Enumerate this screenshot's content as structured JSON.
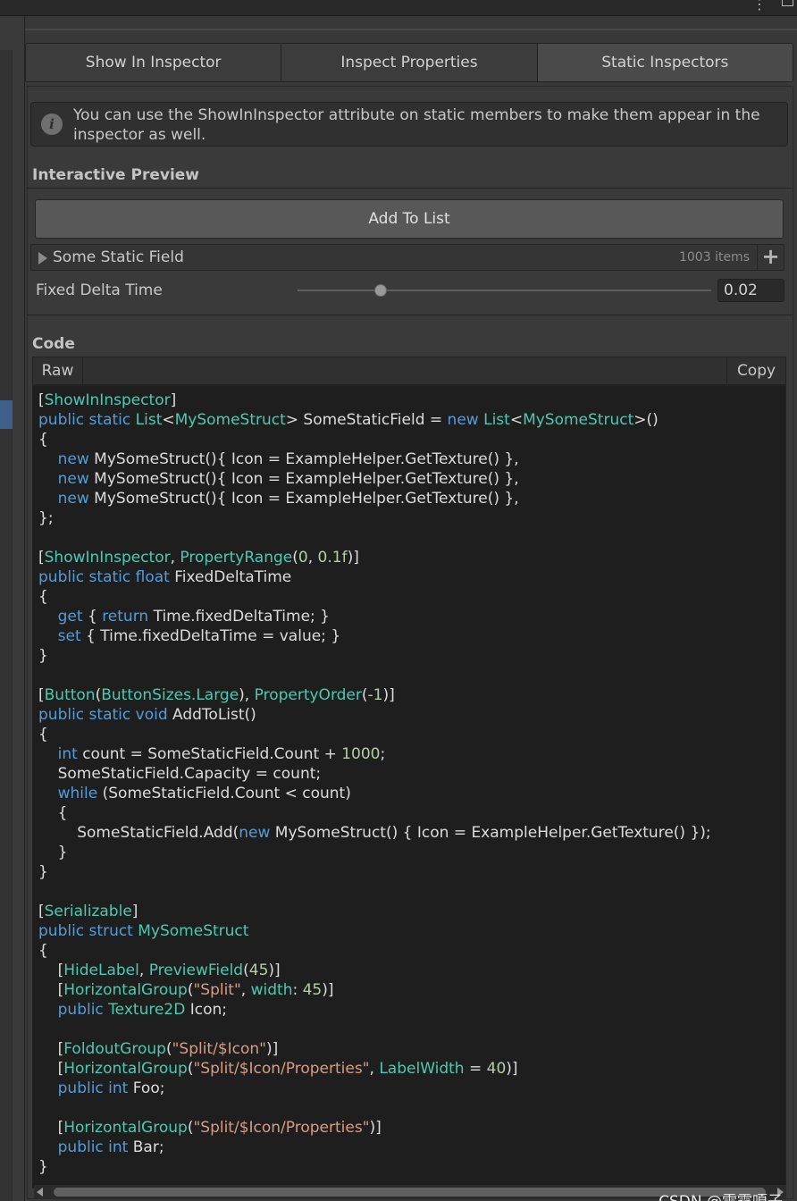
{
  "tabs": [
    {
      "label": "Show In Inspector"
    },
    {
      "label": "Inspect Properties"
    },
    {
      "label": "Static Inspectors"
    }
  ],
  "info": {
    "icon": "info-icon",
    "text": "You can use the ShowInInspector attribute on static members to make them appear in the inspector as well."
  },
  "preview": {
    "title": "Interactive Preview",
    "add_button": "Add To List",
    "list": {
      "label": "Some Static Field",
      "count": "1003 items",
      "add_icon": "plus-icon"
    },
    "slider": {
      "label": "Fixed Delta Time",
      "value": "0.02",
      "min": 0,
      "max": 0.1,
      "level": 0.2
    }
  },
  "code_section": {
    "title": "Code",
    "raw_label": "Raw",
    "copy_label": "Copy",
    "lines": [
      [
        [
          "d",
          "["
        ],
        [
          "t",
          "ShowInInspector"
        ],
        [
          "d",
          "]"
        ]
      ],
      [
        [
          "k",
          "public static "
        ],
        [
          "t",
          "List"
        ],
        [
          "d",
          "<"
        ],
        [
          "t",
          "MySomeStruct"
        ],
        [
          "d",
          "> SomeStaticField = "
        ],
        [
          "k",
          "new "
        ],
        [
          "t",
          "List"
        ],
        [
          "d",
          "<"
        ],
        [
          "t",
          "MySomeStruct"
        ],
        [
          "d",
          ">()"
        ]
      ],
      [
        [
          "d",
          "{"
        ]
      ],
      [
        [
          "d",
          "    "
        ],
        [
          "k",
          "new "
        ],
        [
          "d",
          "MySomeStruct(){ Icon = ExampleHelper.GetTexture() },"
        ]
      ],
      [
        [
          "d",
          "    "
        ],
        [
          "k",
          "new "
        ],
        [
          "d",
          "MySomeStruct(){ Icon = ExampleHelper.GetTexture() },"
        ]
      ],
      [
        [
          "d",
          "    "
        ],
        [
          "k",
          "new "
        ],
        [
          "d",
          "MySomeStruct(){ Icon = ExampleHelper.GetTexture() },"
        ]
      ],
      [
        [
          "d",
          "};"
        ]
      ],
      [],
      [
        [
          "d",
          "["
        ],
        [
          "t",
          "ShowInInspector"
        ],
        [
          "d",
          ", "
        ],
        [
          "t",
          "PropertyRange"
        ],
        [
          "d",
          "("
        ],
        [
          "n",
          "0"
        ],
        [
          "d",
          ", "
        ],
        [
          "n",
          "0.1f"
        ],
        [
          "d",
          ")]"
        ]
      ],
      [
        [
          "k",
          "public static float "
        ],
        [
          "d",
          "FixedDeltaTime"
        ]
      ],
      [
        [
          "d",
          "{"
        ]
      ],
      [
        [
          "d",
          "    "
        ],
        [
          "k",
          "get "
        ],
        [
          "d",
          "{ "
        ],
        [
          "k",
          "return "
        ],
        [
          "d",
          "Time.fixedDeltaTime; }"
        ]
      ],
      [
        [
          "d",
          "    "
        ],
        [
          "k",
          "set "
        ],
        [
          "d",
          "{ Time.fixedDeltaTime = value; }"
        ]
      ],
      [
        [
          "d",
          "}"
        ]
      ],
      [],
      [
        [
          "d",
          "["
        ],
        [
          "t",
          "Button"
        ],
        [
          "d",
          "("
        ],
        [
          "t",
          "ButtonSizes.Large"
        ],
        [
          "d",
          "), "
        ],
        [
          "t",
          "PropertyOrder"
        ],
        [
          "d",
          "("
        ],
        [
          "n",
          "-1"
        ],
        [
          "d",
          ")]"
        ]
      ],
      [
        [
          "k",
          "public static void "
        ],
        [
          "d",
          "AddToList()"
        ]
      ],
      [
        [
          "d",
          "{"
        ]
      ],
      [
        [
          "d",
          "    "
        ],
        [
          "k",
          "int "
        ],
        [
          "d",
          "count = SomeStaticField.Count + "
        ],
        [
          "n",
          "1000"
        ],
        [
          "d",
          ";"
        ]
      ],
      [
        [
          "d",
          "    SomeStaticField.Capacity = count;"
        ]
      ],
      [
        [
          "d",
          "    "
        ],
        [
          "k",
          "while "
        ],
        [
          "d",
          "(SomeStaticField.Count < count)"
        ]
      ],
      [
        [
          "d",
          "    {"
        ]
      ],
      [
        [
          "d",
          "        SomeStaticField.Add("
        ],
        [
          "k",
          "new "
        ],
        [
          "d",
          "MySomeStruct() { Icon = ExampleHelper.GetTexture() });"
        ]
      ],
      [
        [
          "d",
          "    }"
        ]
      ],
      [
        [
          "d",
          "}"
        ]
      ],
      [],
      [
        [
          "d",
          "["
        ],
        [
          "t",
          "Serializable"
        ],
        [
          "d",
          "]"
        ]
      ],
      [
        [
          "k",
          "public struct "
        ],
        [
          "t",
          "MySomeStruct"
        ]
      ],
      [
        [
          "d",
          "{"
        ]
      ],
      [
        [
          "d",
          "    ["
        ],
        [
          "t",
          "HideLabel"
        ],
        [
          "d",
          ", "
        ],
        [
          "t",
          "PreviewField"
        ],
        [
          "d",
          "("
        ],
        [
          "n",
          "45"
        ],
        [
          "d",
          ")]"
        ]
      ],
      [
        [
          "d",
          "    ["
        ],
        [
          "t",
          "HorizontalGroup"
        ],
        [
          "d",
          "("
        ],
        [
          "s",
          "\"Split\""
        ],
        [
          "d",
          ", "
        ],
        [
          "t",
          "width"
        ],
        [
          "d",
          ": "
        ],
        [
          "n",
          "45"
        ],
        [
          "d",
          ")]"
        ]
      ],
      [
        [
          "d",
          "    "
        ],
        [
          "k",
          "public "
        ],
        [
          "t",
          "Texture2D "
        ],
        [
          "d",
          "Icon;"
        ]
      ],
      [],
      [
        [
          "d",
          "    ["
        ],
        [
          "t",
          "FoldoutGroup"
        ],
        [
          "d",
          "("
        ],
        [
          "s",
          "\"Split/$Icon\""
        ],
        [
          "d",
          ")]"
        ]
      ],
      [
        [
          "d",
          "    ["
        ],
        [
          "t",
          "HorizontalGroup"
        ],
        [
          "d",
          "("
        ],
        [
          "s",
          "\"Split/$Icon/Properties\""
        ],
        [
          "d",
          ", "
        ],
        [
          "t",
          "LabelWidth"
        ],
        [
          "d",
          " = "
        ],
        [
          "n",
          "40"
        ],
        [
          "d",
          ")]"
        ]
      ],
      [
        [
          "d",
          "    "
        ],
        [
          "k",
          "public int "
        ],
        [
          "d",
          "Foo;"
        ]
      ],
      [],
      [
        [
          "d",
          "    ["
        ],
        [
          "t",
          "HorizontalGroup"
        ],
        [
          "d",
          "("
        ],
        [
          "s",
          "\"Split/$Icon/Properties\""
        ],
        [
          "d",
          ")]"
        ]
      ],
      [
        [
          "d",
          "    "
        ],
        [
          "k",
          "public int "
        ],
        [
          "d",
          "Bar;"
        ]
      ],
      [
        [
          "d",
          "}"
        ]
      ]
    ]
  },
  "watermark": "CSDN @雷霆嘎子",
  "colors": {
    "keyword": "#569cd6",
    "type": "#4ec9b0",
    "number": "#b5cea8",
    "string": "#d69d85",
    "default": "#dcdcdc"
  }
}
